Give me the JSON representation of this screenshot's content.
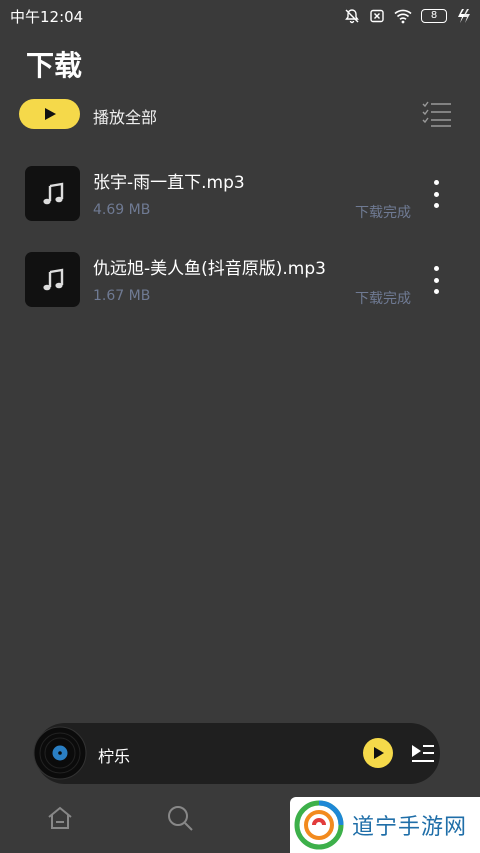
{
  "status_bar": {
    "time": "中午12:04",
    "battery": "8"
  },
  "header": {
    "title": "下载",
    "play_all_label": "播放全部"
  },
  "songs": [
    {
      "title": "张宇-雨一直下.mp3",
      "size": "4.69 MB",
      "status": "下载完成"
    },
    {
      "title": "仇远旭-美人鱼(抖音原版).mp3",
      "size": "1.67 MB",
      "status": "下载完成"
    }
  ],
  "mini_player": {
    "track_name": "柠乐"
  },
  "watermark": {
    "text": "道宁手游网"
  },
  "colors": {
    "background": "#3a3a3a",
    "accent": "#f5d94a",
    "secondary_text": "#6f7a93",
    "thumb_background": "#111111",
    "player_background": "#1f1f1f"
  }
}
